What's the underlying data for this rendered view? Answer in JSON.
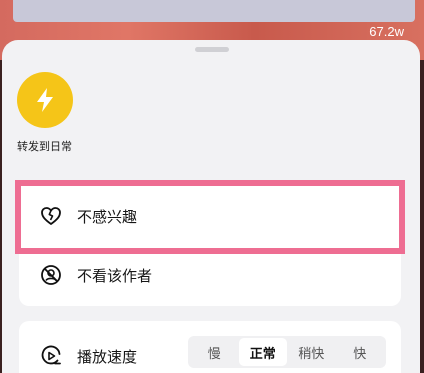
{
  "video": {
    "count": "67.2w"
  },
  "share": {
    "label": "转发到日常",
    "icon": "lightning-icon",
    "color": "#f5c518"
  },
  "menu": {
    "items": [
      {
        "label": "不感兴趣",
        "icon": "broken-heart-icon"
      },
      {
        "label": "不看该作者",
        "icon": "block-user-icon"
      }
    ]
  },
  "speed": {
    "label": "播放速度",
    "icon": "playback-speed-icon",
    "options": [
      "慢",
      "正常",
      "稍快",
      "快"
    ],
    "selected": "正常"
  },
  "highlight_color": "#ee6d92"
}
